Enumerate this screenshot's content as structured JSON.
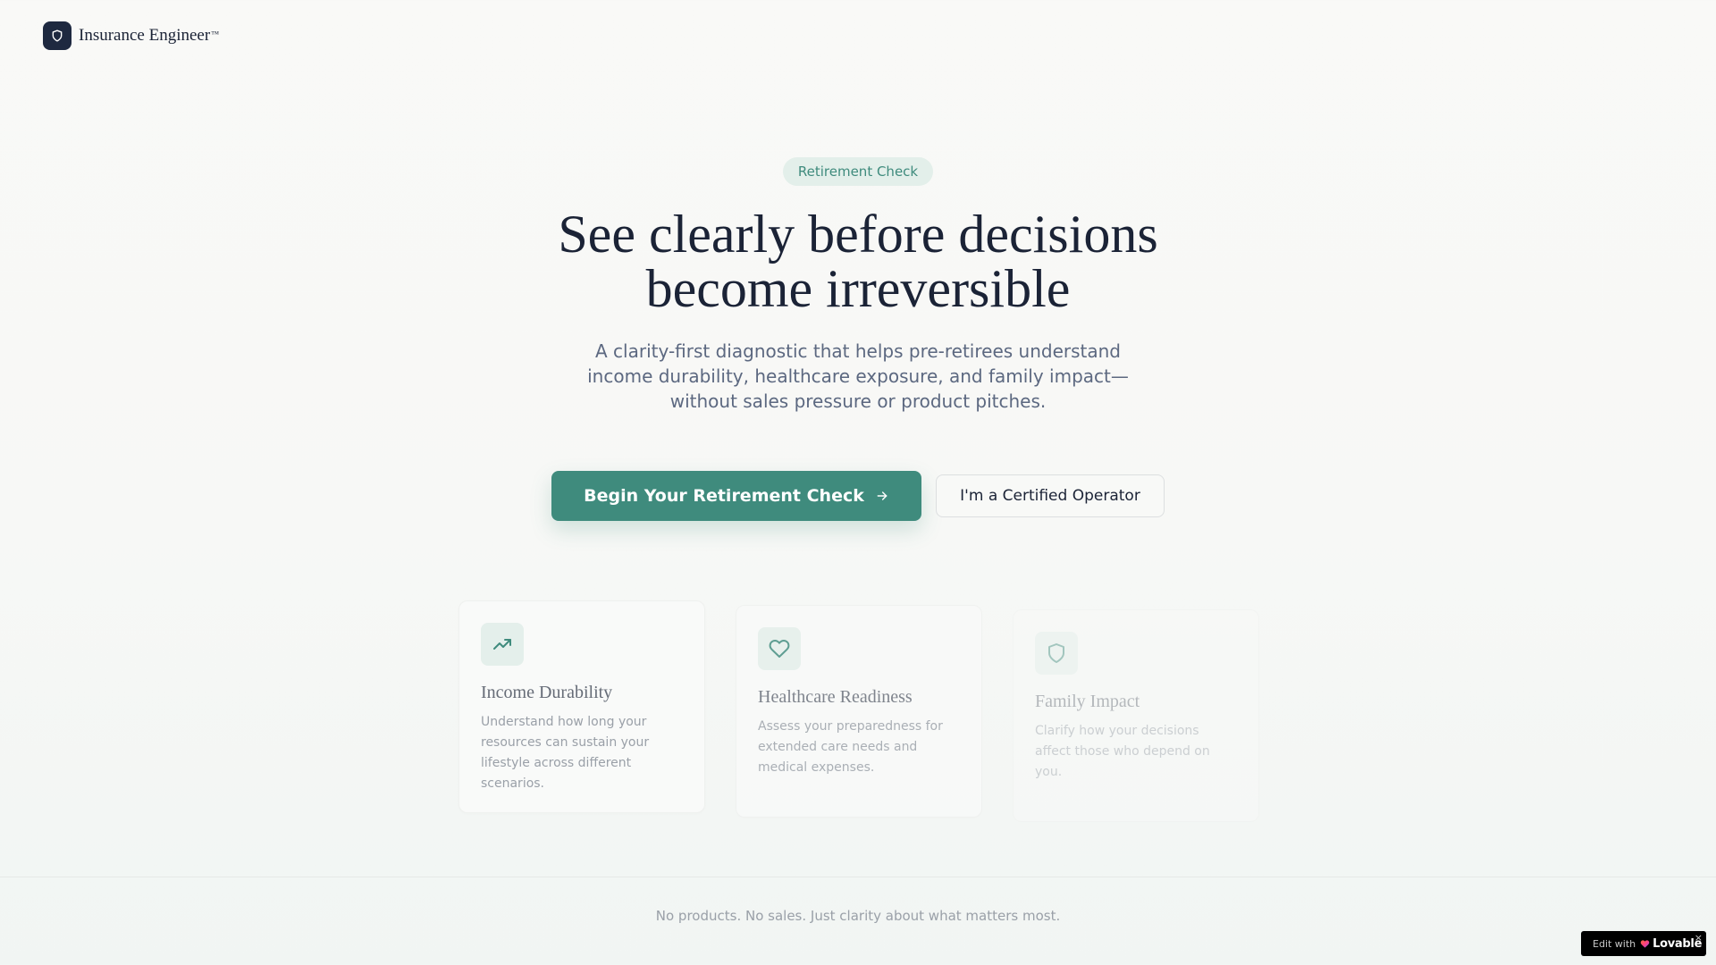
{
  "header": {
    "brand": "Insurance Engineer",
    "brand_mark": "™",
    "logo_icon": "shield-icon"
  },
  "hero": {
    "badge": "Retirement Check",
    "title_line1": "See clearly before decisions",
    "title_line2": "become irreversible",
    "subtitle": "A clarity-first diagnostic that helps pre-retirees understand income durability, healthcare exposure, and family impact—without sales pressure or product pitches.",
    "primary_cta": "Begin Your Retirement Check",
    "primary_cta_icon": "arrow-right-icon",
    "secondary_cta": "I'm a Certified Operator"
  },
  "cards": [
    {
      "icon": "trending-up-icon",
      "title": "Income Durability",
      "description": "Understand how long your resources can sustain your lifestyle across different scenarios."
    },
    {
      "icon": "heart-icon",
      "title": "Healthcare Readiness",
      "description": "Assess your preparedness for extended care needs and medical expenses."
    },
    {
      "icon": "shield-icon",
      "title": "Family Impact",
      "description": "Clarify how your decisions affect those who depend on you."
    }
  ],
  "footer": {
    "text": "No products. No sales. Just clarity about what matters most."
  },
  "lovable_badge": {
    "prefix": "Edit with",
    "brand": "Lovable",
    "close": "×"
  },
  "colors": {
    "accent": "#3f8b7d",
    "navy": "#1e2940",
    "badge_bg": "#e4efeb",
    "muted_text": "#5c6880"
  }
}
